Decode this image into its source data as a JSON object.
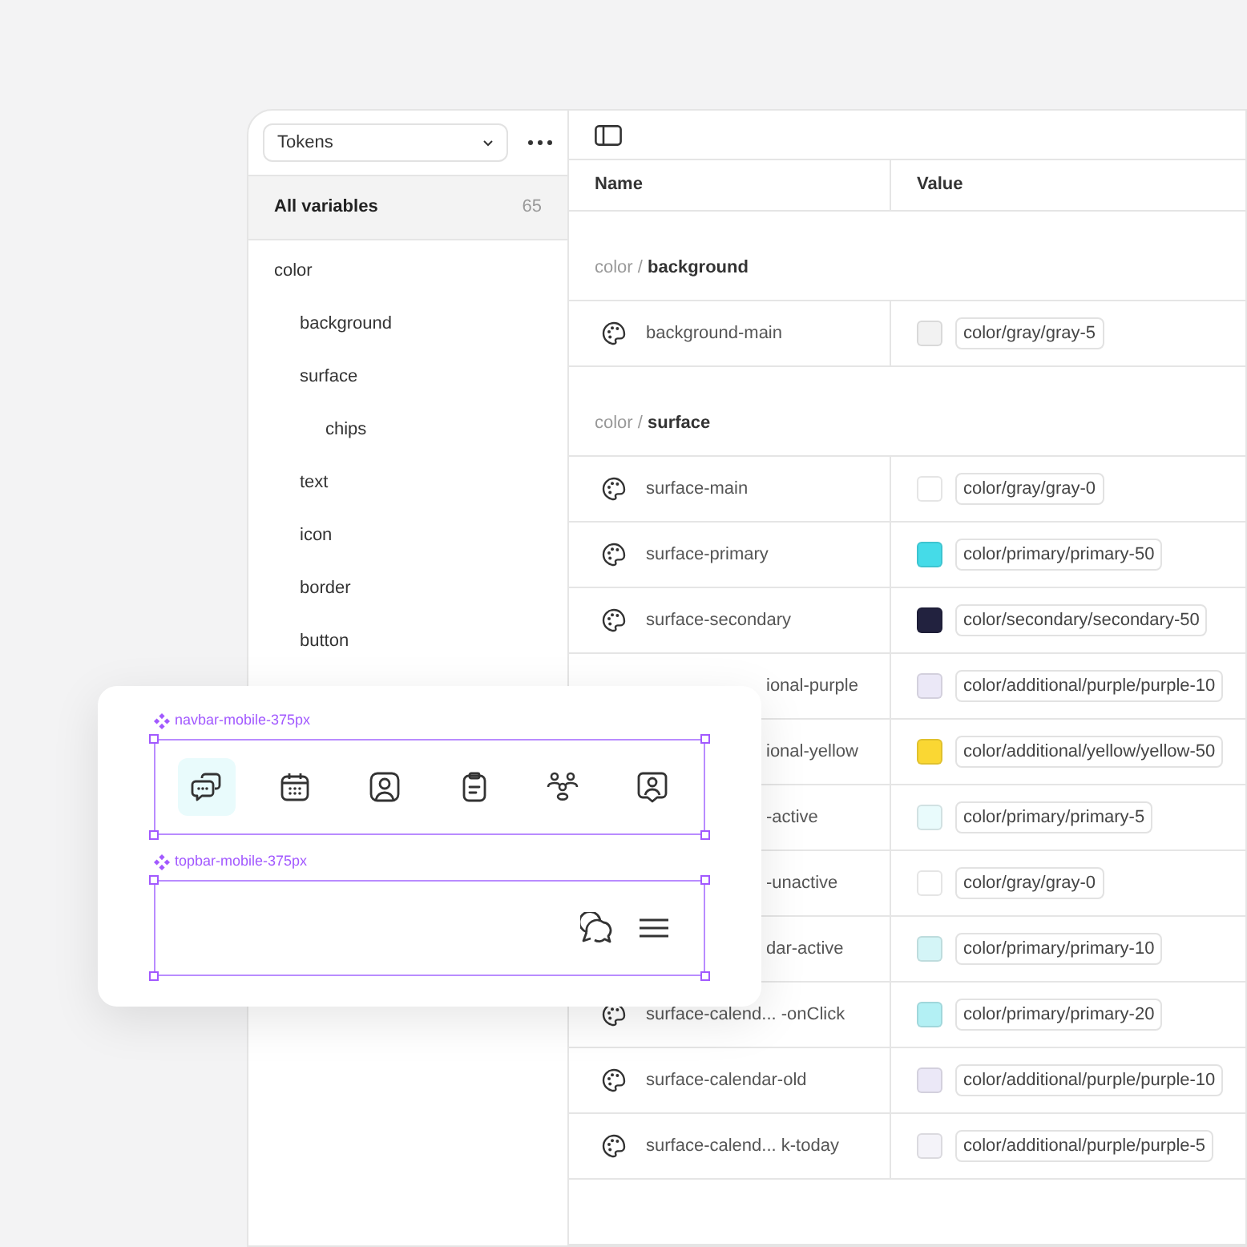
{
  "sidebar": {
    "dropdown": {
      "value": "Tokens"
    },
    "all_variables": {
      "label": "All variables",
      "count": "65",
      "selected": true
    },
    "tree": [
      {
        "label": "color",
        "children": [
          {
            "label": "background"
          },
          {
            "label": "surface",
            "children": [
              {
                "label": "chips"
              }
            ]
          },
          {
            "label": "text"
          },
          {
            "label": "icon"
          },
          {
            "label": "border"
          },
          {
            "label": "button"
          }
        ]
      }
    ]
  },
  "table": {
    "columns": [
      "Name",
      "Value"
    ],
    "groups": [
      {
        "path": "color /",
        "name": "background",
        "rows": [
          {
            "name": "background-main",
            "covered": false,
            "color": "#f2f2f2",
            "value": "color/gray/gray-5"
          }
        ]
      },
      {
        "path": "color /",
        "name": "surface",
        "rows": [
          {
            "name": "surface-main",
            "covered": false,
            "color": "#ffffff",
            "value": "color/gray/gray-0"
          },
          {
            "name": "surface-primary",
            "covered": false,
            "color": "#45dbe8",
            "value": "color/primary/primary-50"
          },
          {
            "name": "surface-secondary",
            "covered": false,
            "color": "#22223f",
            "value": "color/secondary/secondary-50"
          },
          {
            "name": "ional-purple",
            "covered": true,
            "color": "#ebe8f7",
            "value": "color/additional/purple/purple-10"
          },
          {
            "name": "ional-yellow",
            "covered": true,
            "color": "#fad733",
            "value": "color/additional/yellow/yellow-50"
          },
          {
            "name": "-active",
            "covered": true,
            "color": "#e9fbfc",
            "value": "color/primary/primary-5"
          },
          {
            "name": "-unactive",
            "covered": true,
            "color": "#ffffff",
            "value": "color/gray/gray-0"
          },
          {
            "name": "dar-active",
            "covered": true,
            "color": "#d4f5f7",
            "value": "color/primary/primary-10"
          },
          {
            "name": "surface-calend... -onClick",
            "covered": false,
            "color": "#b3f0f4",
            "value": "color/primary/primary-20"
          },
          {
            "name": "surface-calendar-old",
            "covered": false,
            "color": "#ebe8f7",
            "value": "color/additional/purple/purple-10"
          },
          {
            "name": "surface-calend... k-today",
            "covered": false,
            "color": "#f4f3f9",
            "value": "color/additional/purple/purple-5"
          }
        ]
      }
    ]
  },
  "canvas_card": {
    "components": [
      {
        "kind": "navbar",
        "label": "navbar-mobile-375px",
        "items": [
          {
            "selected": true
          },
          {
            "selected": false
          },
          {
            "selected": false
          },
          {
            "selected": false
          },
          {
            "selected": false
          },
          {
            "selected": false
          }
        ]
      },
      {
        "kind": "topbar",
        "label": "topbar-mobile-375px"
      }
    ]
  }
}
